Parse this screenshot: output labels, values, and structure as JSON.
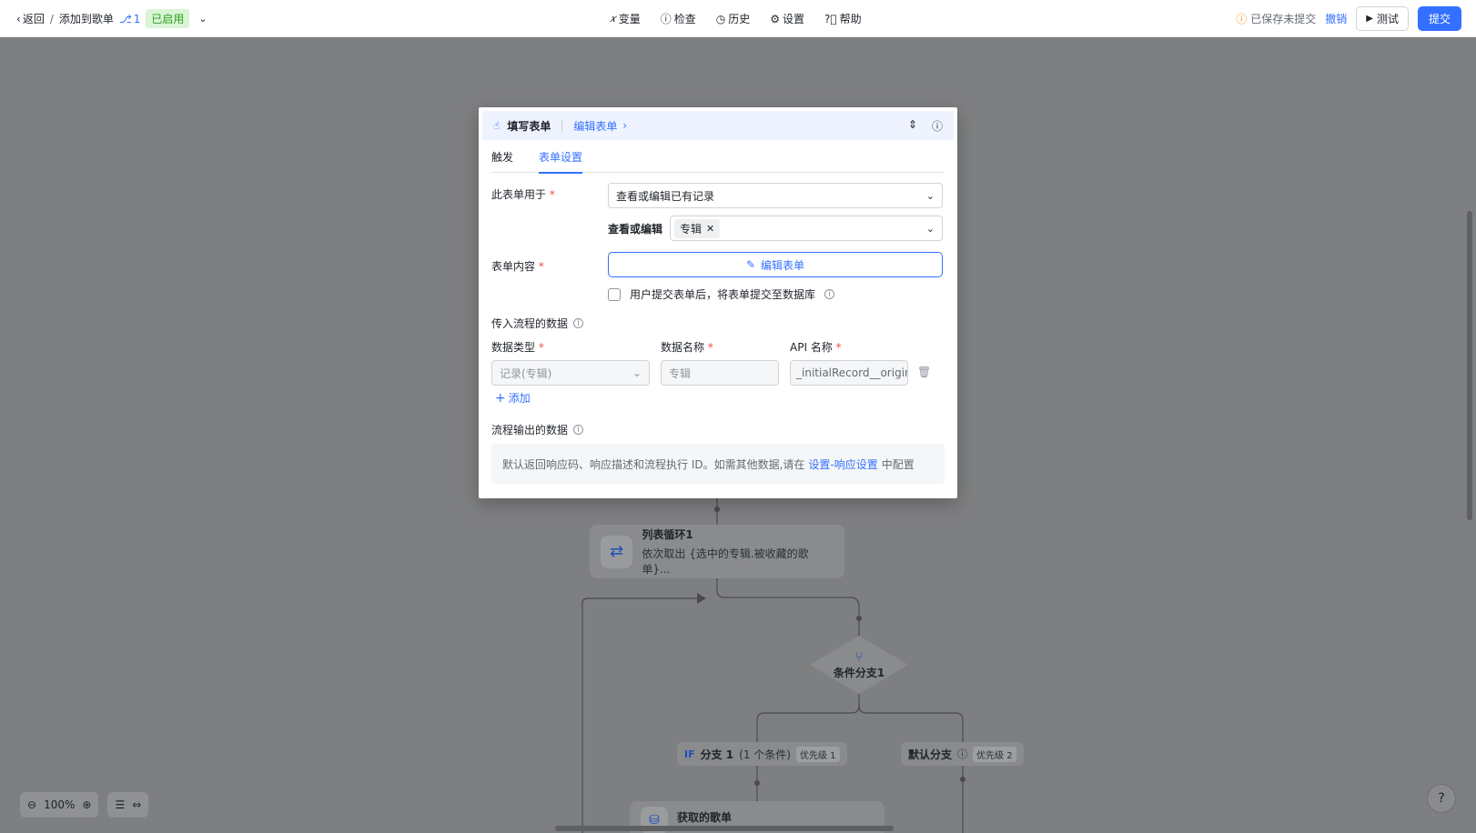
{
  "topbar": {
    "back_label": "返回",
    "title": "添加到歌单",
    "version": "1",
    "status": "已启用",
    "menu": [
      {
        "icon": "variable-icon",
        "label": "变量"
      },
      {
        "icon": "check-icon",
        "label": "检查"
      },
      {
        "icon": "history-icon",
        "label": "历史"
      },
      {
        "icon": "gear-icon",
        "label": "设置"
      },
      {
        "icon": "help-icon",
        "label": "帮助"
      }
    ],
    "save_status": "已保存未提交",
    "undo_label": "撤销",
    "test_label": "测试",
    "submit_label": "提交"
  },
  "dialog": {
    "title": "填写表单",
    "edit_link": "编辑表单",
    "tabs": [
      "触发",
      "表单设置"
    ],
    "active_tab": 1,
    "form_use_label": "此表单用于",
    "form_use_value": "查看或编辑已有记录",
    "view_edit_label": "查看或编辑",
    "view_edit_tag": "专辑",
    "form_content_label": "表单内容",
    "edit_form_button": "编辑表单",
    "submit_checkbox_label": "用户提交表单后，将表单提交至数据库",
    "input_data_label": "传入流程的数据",
    "col_data_type": "数据类型",
    "col_data_name": "数据名称",
    "col_api_name": "API 名称",
    "row_data_type": "记录(专辑)",
    "row_data_name": "专辑",
    "row_api_name": "_initialRecord__origin",
    "add_label": "添加",
    "output_data_label": "流程输出的数据",
    "output_text": "默认返回响应码、响应描述和流程执行 ID。如需其他数据,请在",
    "output_link": "设置-响应设置",
    "output_suffix": "中配置"
  },
  "canvas": {
    "loop_node": {
      "title": "列表循环1",
      "subtitle": "依次取出 {选中的专辑.被收藏的歌单}..."
    },
    "branch_node": {
      "title": "条件分支1"
    },
    "branch1": {
      "prefix": "IF",
      "label": "分支 1",
      "cond": "(1 个条件)",
      "priority": "优先级 1"
    },
    "default_branch": {
      "label": "默认分支",
      "priority": "优先级 2"
    },
    "get_node": {
      "title": "获取的歌单"
    },
    "zoom": "100%"
  },
  "colors": {
    "accent": "#3370ff",
    "enabled_bg": "#d9f5d6",
    "enabled_text": "#2ea121",
    "required": "#f54a45"
  }
}
